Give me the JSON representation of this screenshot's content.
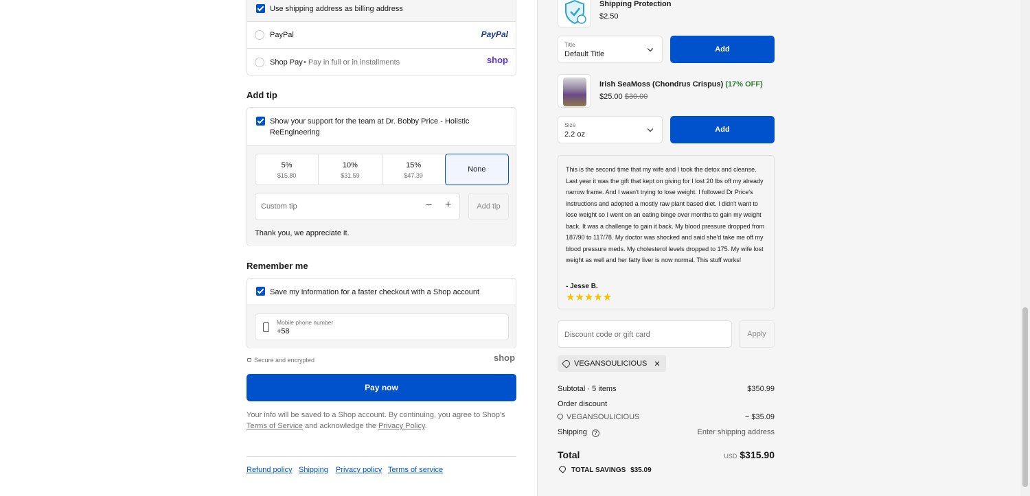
{
  "payment": {
    "billing_same": "Use shipping address as billing address",
    "paypal_label": "PayPal",
    "paypal_logo": "PayPal",
    "shoppay_label": "Shop Pay",
    "shoppay_sub": "• Pay in full or in installments",
    "shoppay_logo": "shop"
  },
  "tip": {
    "heading": "Add tip",
    "support_text_1": "Show your support for the team at Dr. Bobby Price - Holistic",
    "support_text_2": "ReEngineering",
    "options": [
      {
        "pct": "5%",
        "amount": "$15.80"
      },
      {
        "pct": "10%",
        "amount": "$31.59"
      },
      {
        "pct": "15%",
        "amount": "$47.39"
      },
      {
        "pct": "None",
        "amount": ""
      }
    ],
    "custom_placeholder": "Custom tip",
    "minus": "−",
    "plus": "+",
    "add_tip_label": "Add tip",
    "thanks": "Thank you, we appreciate it."
  },
  "remember": {
    "heading": "Remember me",
    "save_info": "Save my information for a faster checkout with a Shop account",
    "phone_label": "Mobile phone number",
    "phone_value": "+58"
  },
  "secure": {
    "text": "Secure and encrypted",
    "logo": "shop"
  },
  "pay_now": "Pay now",
  "consent": {
    "line1": "Your info will be saved to a Shop account. By continuing, you agree to Shop's",
    "terms": "Terms of Service",
    "and_ack": " and acknowledge the ",
    "privacy": "Privacy Policy",
    "period": "."
  },
  "footer_links": [
    "Refund policy",
    "Shipping",
    "Privacy policy",
    "Terms of service"
  ],
  "upsells": [
    {
      "name": "Shipping Protection",
      "price": "$2.50",
      "select_label": "Title",
      "select_value": "Default Title",
      "add_label": "Add"
    },
    {
      "name": "Irish SeaMoss (Chondrus Crispus)",
      "discount": "(17% OFF)",
      "price": "$25.00",
      "compare_price": "$30.00",
      "select_label": "Size",
      "select_value": "2.2 oz",
      "add_label": "Add"
    }
  ],
  "review": {
    "text": "This is the second time that my wife and I took the detox and cleanse. Last year it was the gift that kept on giving for I lost 20 lbs off my already narrow frame. And I wasn't trying to lose weight. I followed Dr Price's instructions and adopted a mostly raw plant based diet. I didn't want to lose weight so I went on an eating binge over months to gain my weight back. It was a challenge to gain it back. My blood pressure dropped from 187/90 to 117/78. My doctor was shocked and said she'd take me off my blood pressure meds. My cholesterol levels dropped to 175. My wife lost weight as well and her fatty liver is now normal. This stuff works!",
    "author": "- Jesse B.",
    "stars": "★★★★★"
  },
  "discount": {
    "placeholder": "Discount code or gift card",
    "apply_label": "Apply",
    "applied_code": "VEGANSOULICIOUS",
    "remove": "✕"
  },
  "summary": {
    "subtotal_label": "Subtotal · 5 items",
    "subtotal_value": "$350.99",
    "order_discount_label": "Order discount",
    "discount_code": "VEGANSOULICIOUS",
    "discount_value": "− $35.09",
    "shipping_label": "Shipping",
    "shipping_value": "Enter shipping address",
    "total_label": "Total",
    "currency": "USD",
    "total_value": "$315.90",
    "savings_label": "TOTAL SAVINGS",
    "savings_value": "$35.09"
  },
  "colors": {
    "accent": "#0052cc",
    "discount_green": "#2e7d32",
    "star": "#f2c200"
  }
}
